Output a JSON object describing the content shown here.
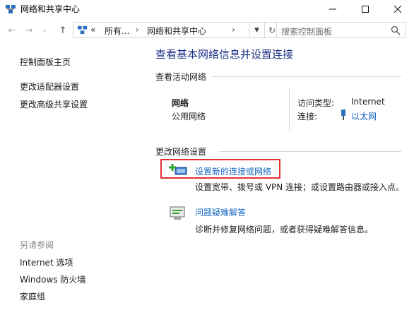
{
  "window": {
    "title": "网络和共享中心",
    "controls": {
      "minimize": "—",
      "maximize": "☐",
      "close": "✕"
    }
  },
  "nav": {
    "breadcrumb": [
      "«",
      "所有...",
      "›",
      "网络和共享中心",
      "›"
    ],
    "search_placeholder": "搜索控制面板"
  },
  "sidebar": {
    "home": "控制面板主页",
    "links": [
      "更改适配器设置",
      "更改高级共享设置"
    ],
    "see_also_heading": "另请参阅",
    "see_also": [
      "Internet 选项",
      "Windows 防火墙",
      "家庭组"
    ]
  },
  "main": {
    "title": "查看基本网络信息并设置连接",
    "active_networks_label": "查看活动网络",
    "network_name": "网络",
    "network_type": "公用网络",
    "access_type_label": "访问类型:",
    "access_type_value": "Internet",
    "connection_label": "连接:",
    "connection_value": "以太网",
    "change_settings_label": "更改网络设置",
    "actions": [
      {
        "title": "设置新的连接或网络",
        "desc": "设置宽带、拨号或 VPN 连接；或设置路由器或接入点。",
        "icon": "new-connection-icon"
      },
      {
        "title": "问题疑难解答",
        "desc": "诊断并修复网络问题，或者获得疑难解答信息。",
        "icon": "troubleshoot-icon"
      }
    ]
  },
  "colors": {
    "title_blue": "#1e3287",
    "link_blue": "#1666c1",
    "highlight_red": "#e03131"
  }
}
